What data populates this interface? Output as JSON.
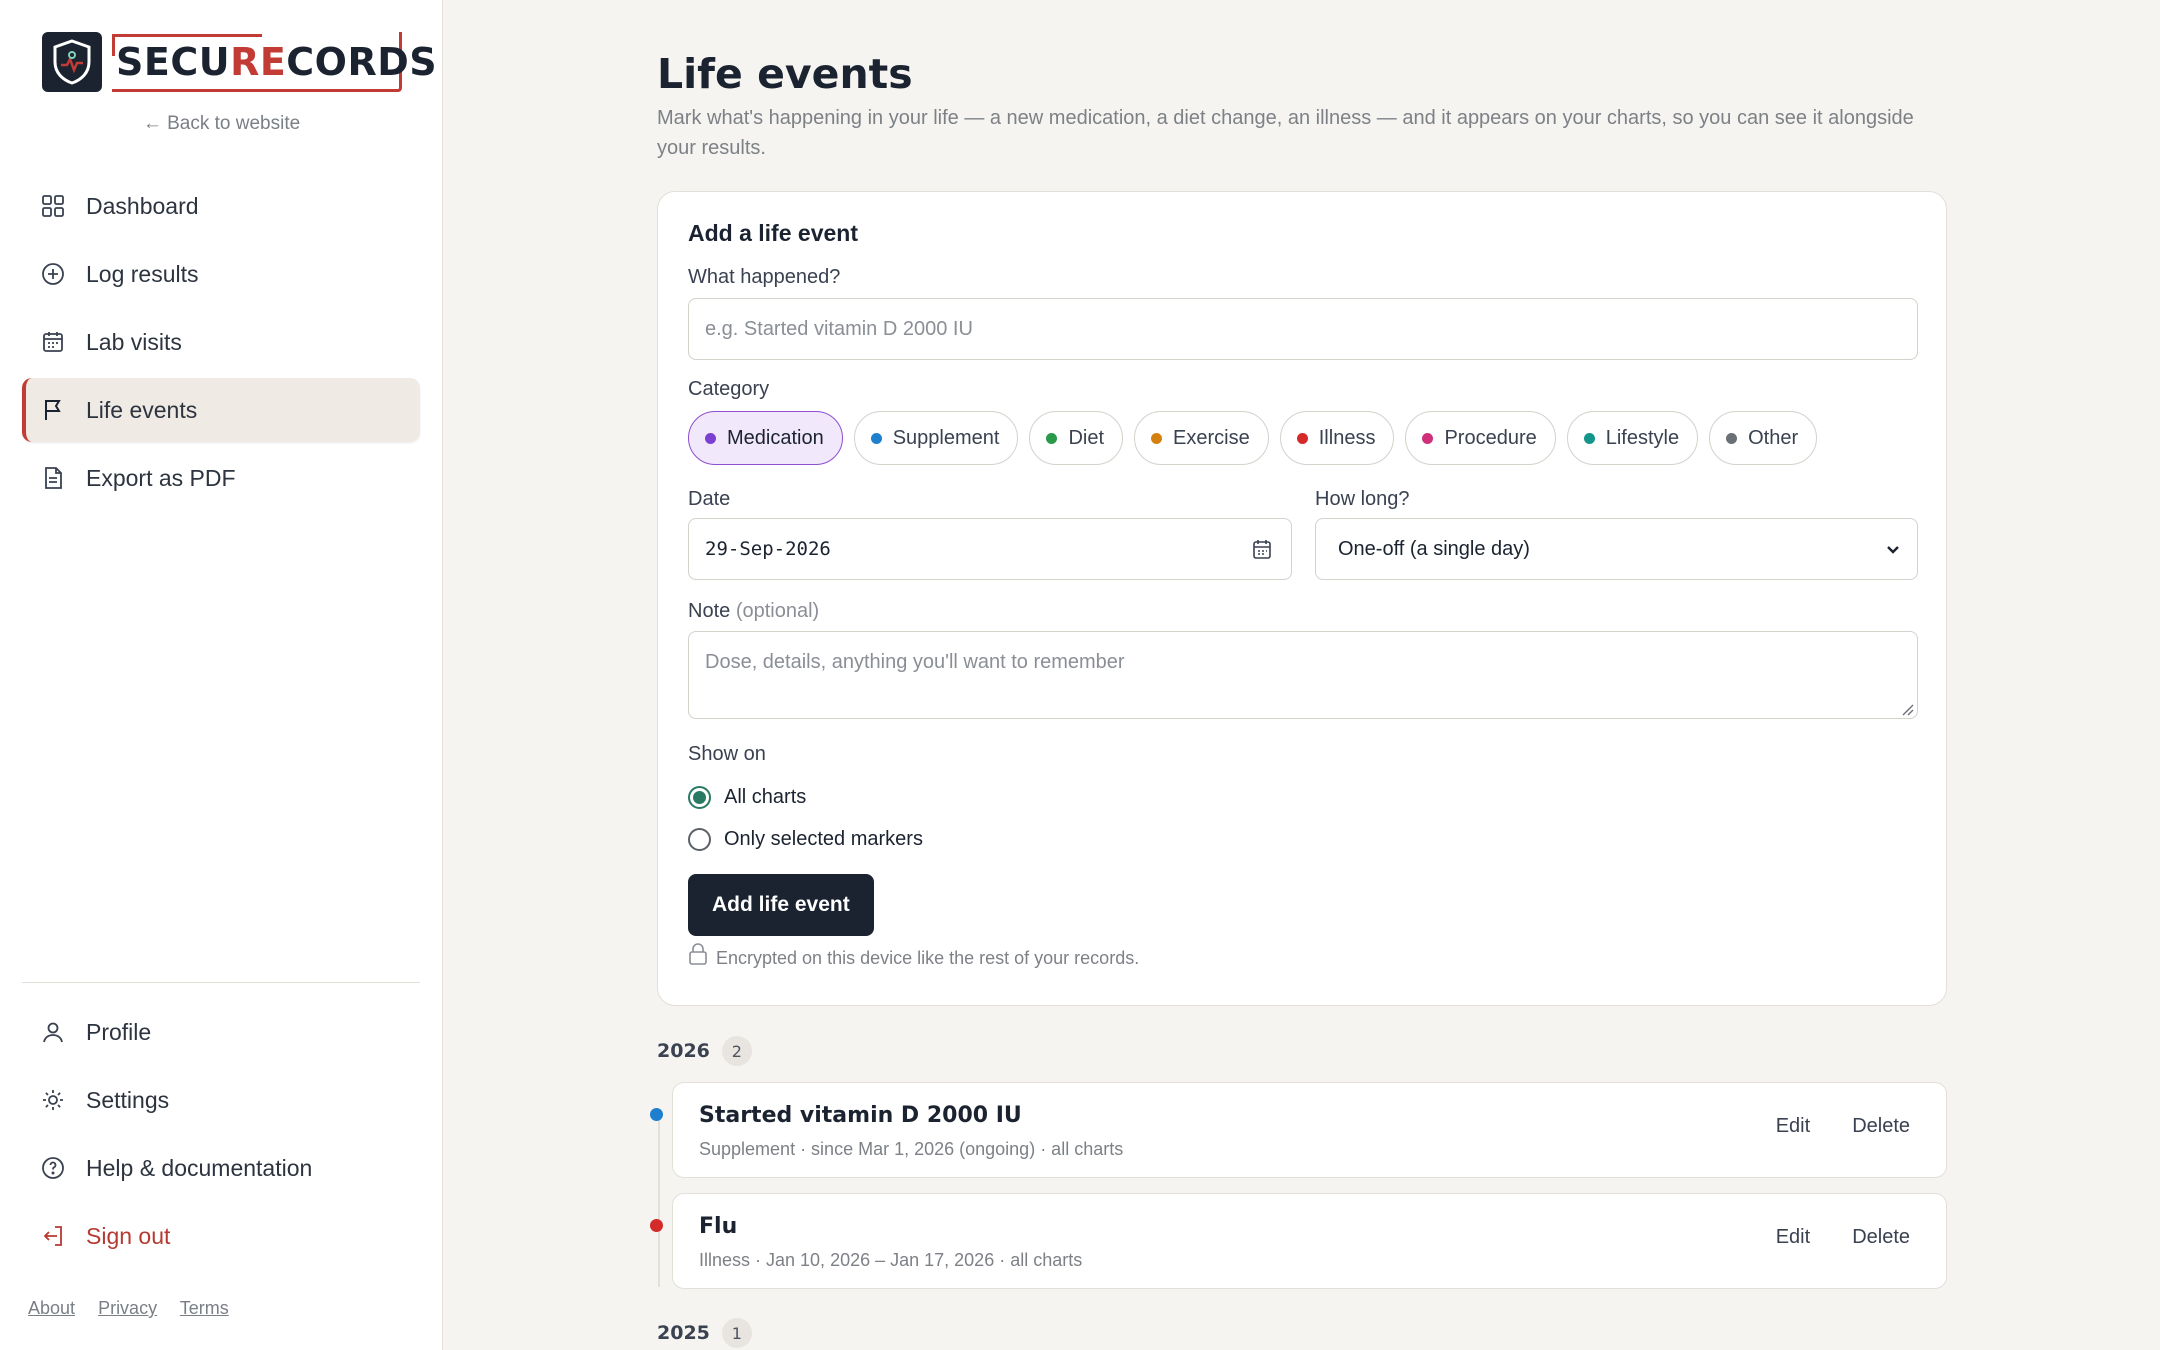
{
  "brand": {
    "name_part1": "SECU",
    "name_part2": "RE",
    "name_part3": "CORDS",
    "back_link": "← Back to website",
    "accent": "#c23b34"
  },
  "nav": {
    "items": [
      {
        "label": "Dashboard",
        "icon": "grid-icon"
      },
      {
        "label": "Log results",
        "icon": "plus-circle-icon"
      },
      {
        "label": "Lab visits",
        "icon": "calendar-icon"
      },
      {
        "label": "Life events",
        "icon": "flag-icon",
        "active": true
      },
      {
        "label": "Export as PDF",
        "icon": "document-icon"
      }
    ],
    "bottom": [
      {
        "label": "Profile",
        "icon": "user-icon"
      },
      {
        "label": "Settings",
        "icon": "sun-gear-icon"
      },
      {
        "label": "Help & documentation",
        "icon": "help-circle-icon"
      },
      {
        "label": "Sign out",
        "icon": "sign-out-icon"
      }
    ],
    "footer": [
      "About",
      "Privacy",
      "Terms"
    ]
  },
  "page": {
    "title": "Life events",
    "subtitle": "Mark what's happening in your life — a new medication, a diet change, an illness — and it appears on your charts, so you can see it alongside your results."
  },
  "form": {
    "title": "Add a life event",
    "what_label": "What happened?",
    "what_placeholder": "e.g. Started vitamin D 2000 IU",
    "category_label": "Category",
    "categories": [
      {
        "label": "Medication",
        "color": "#7b3fd1",
        "selected": true
      },
      {
        "label": "Supplement",
        "color": "#1f7fcf"
      },
      {
        "label": "Diet",
        "color": "#2a9a4a"
      },
      {
        "label": "Exercise",
        "color": "#d4800f"
      },
      {
        "label": "Illness",
        "color": "#d42a2a"
      },
      {
        "label": "Procedure",
        "color": "#d0307a"
      },
      {
        "label": "Lifestyle",
        "color": "#14958a"
      },
      {
        "label": "Other",
        "color": "#6b6f76"
      }
    ],
    "date_label": "Date",
    "date_value": "29-Sep-2026",
    "duration_label": "How long?",
    "duration_value": "One-off (a single day)",
    "note_label": "Note",
    "note_optional": "(optional)",
    "note_placeholder": "Dose, details, anything you'll want to remember",
    "show_on_label": "Show on",
    "show_on_options": [
      {
        "label": "All charts",
        "selected": true
      },
      {
        "label": "Only selected markers",
        "selected": false
      }
    ],
    "submit": "Add life event",
    "encrypted_note": "Encrypted on this device like the rest of your records."
  },
  "timeline": {
    "groups": [
      {
        "year": "2026",
        "count": "2",
        "events": [
          {
            "title": "Started vitamin D 2000 IU",
            "meta": "Supplement · since Mar 1, 2026 (ongoing) · all charts",
            "color": "#1f7fcf"
          },
          {
            "title": "Flu",
            "meta": "Illness · Jan 10, 2026 – Jan 17, 2026 · all charts",
            "color": "#d42a2a"
          }
        ]
      },
      {
        "year": "2025",
        "count": "1",
        "events": []
      }
    ],
    "edit": "Edit",
    "delete": "Delete"
  }
}
